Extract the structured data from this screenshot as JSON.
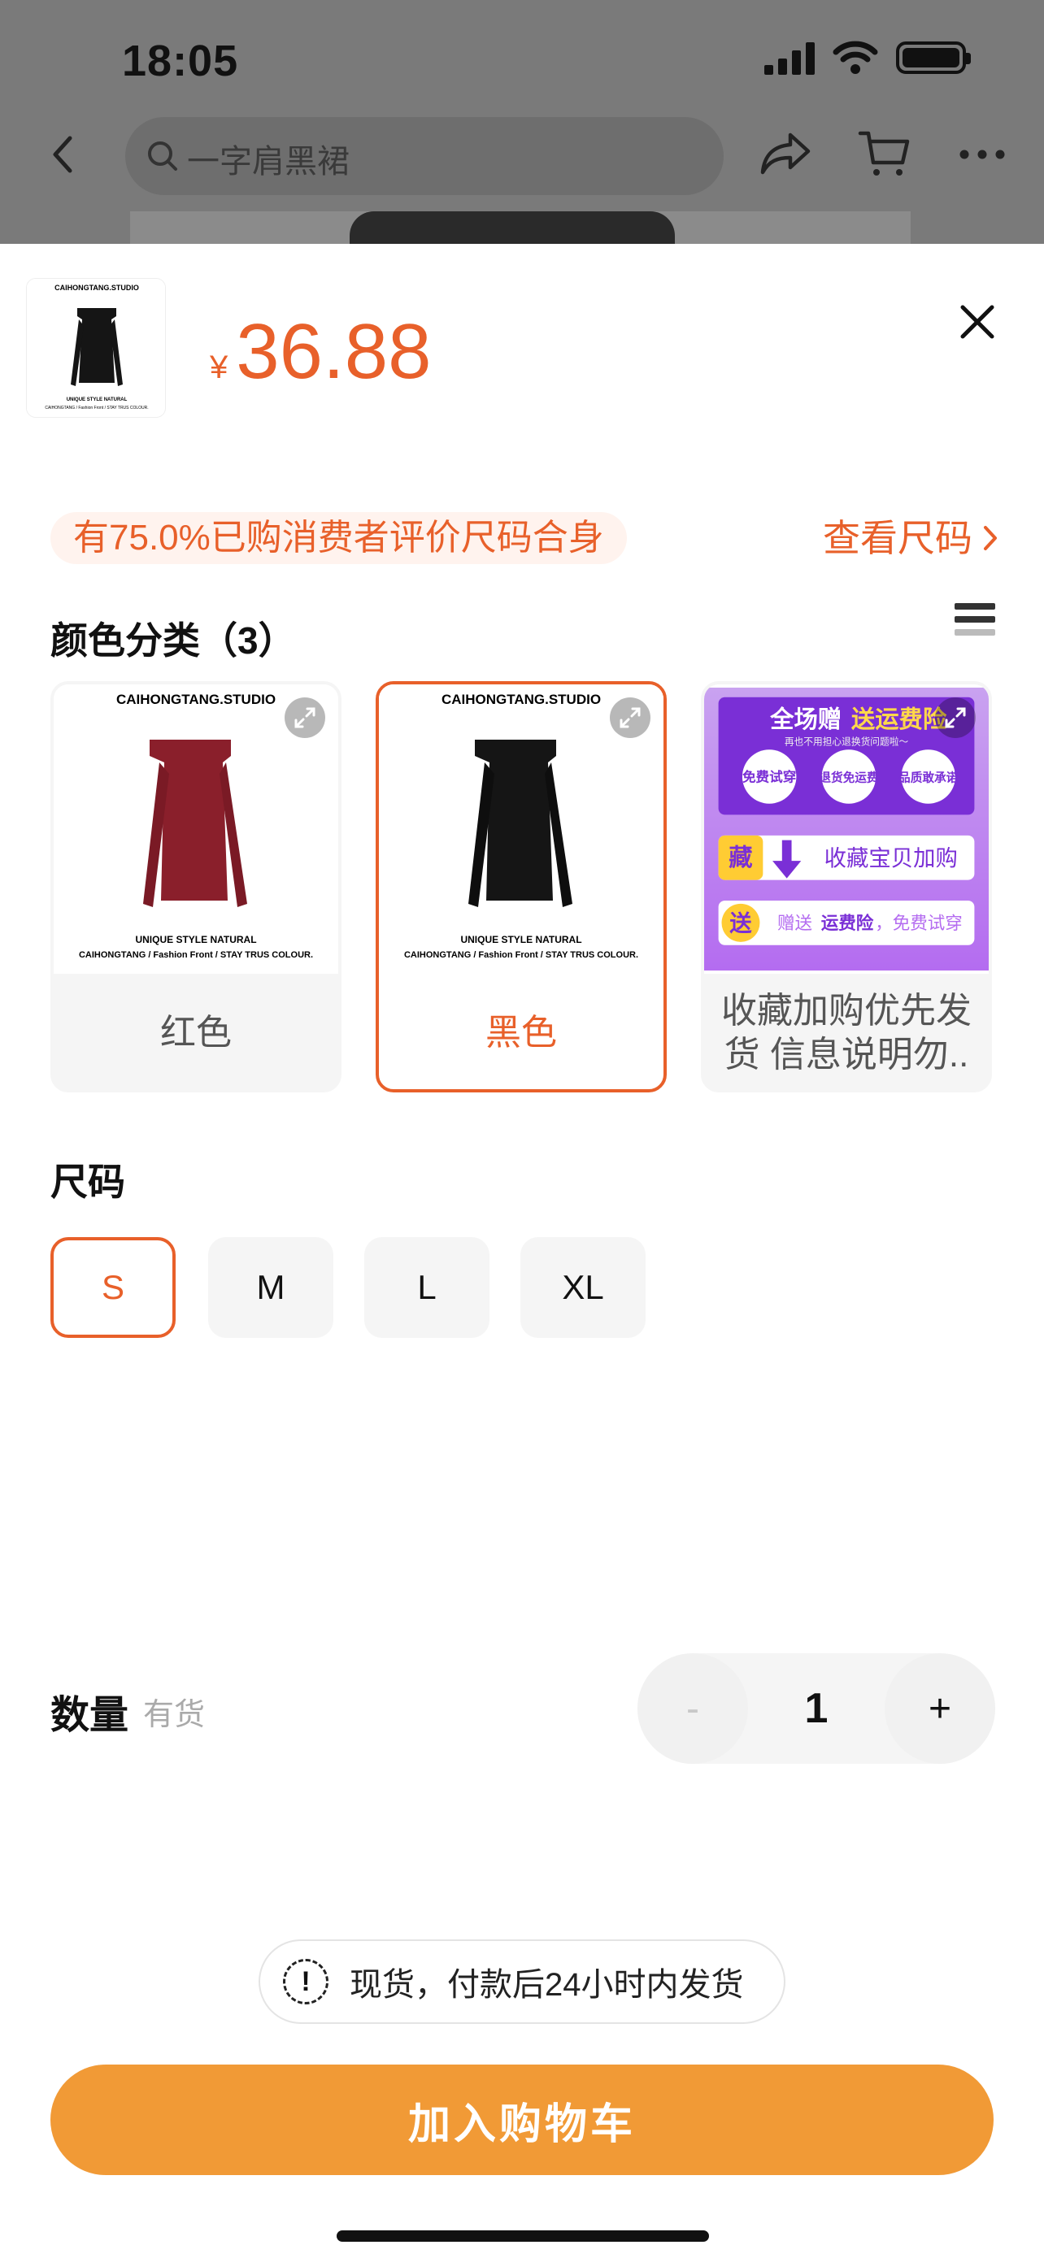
{
  "status_bar": {
    "time": "18:05"
  },
  "nav": {
    "search_text": "一字肩黑裙"
  },
  "sheet": {
    "price_currency": "¥",
    "price_value": "36.88",
    "fit_tip": "有75.0%已购消费者评价尺码合身",
    "size_chart_link": "查看尺码",
    "color_section_title": "颜色分类（3）",
    "variants": [
      {
        "label": "红色",
        "dress_color": "#8a1f2b"
      },
      {
        "label": "黑色",
        "dress_color": "#151515"
      },
      {
        "label": "收藏加购优先发货 信息说明勿..",
        "promo": {
          "headline_a": "全场赠",
          "headline_b": "送运费险",
          "sub": "再也不用担心退换货问题啦～",
          "badges": [
            "免费试穿",
            "退货免运费",
            "品质敢承诺"
          ],
          "collect_badge": "藏",
          "collect_text": "收藏宝贝加购",
          "gift_badge": "送",
          "gift_text_a": "赠送",
          "gift_text_b": "运费险",
          "gift_text_c": "，免费试穿"
        }
      }
    ],
    "product_image_text": {
      "brand": "CAIHONGTANG.STUDIO",
      "tagline": "UNIQUE  STYLE  NATURAL",
      "footer": "CAIHONGTANG / Fashion Front / STAY TRUS COLOUR."
    },
    "size_section_title": "尺码",
    "sizes": [
      "S",
      "M",
      "L",
      "XL"
    ],
    "selected_size": "S",
    "selected_color": "黑色",
    "quantity_label": "数量",
    "stock_status": "有货",
    "quantity": "1",
    "minus": "-",
    "plus": "+",
    "shipping_notice": "现货，付款后24小时内发货",
    "add_to_cart": "加入购物车"
  },
  "colors": {
    "accent": "#e8602a",
    "cta": "#f19a36"
  }
}
